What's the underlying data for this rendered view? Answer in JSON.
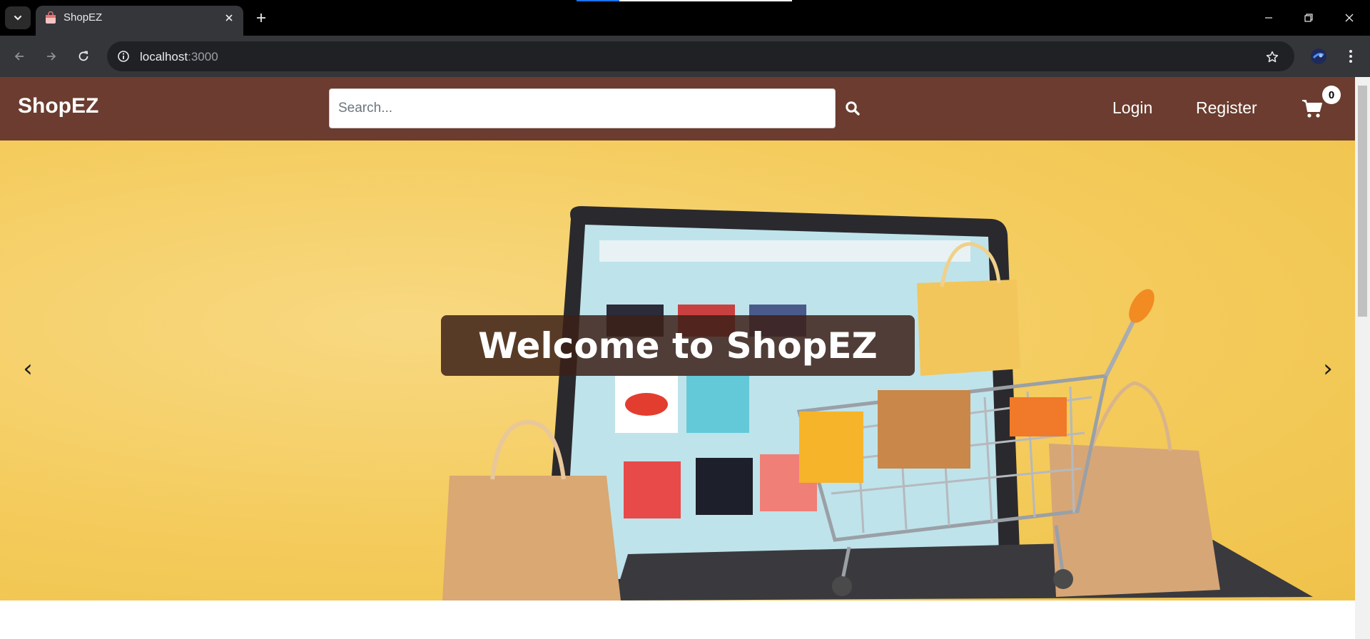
{
  "browser": {
    "tab_title": "ShopEZ",
    "url_host": "localhost",
    "url_port": ":3000"
  },
  "site": {
    "brand": "ShopEZ",
    "search_placeholder": "Search...",
    "nav": {
      "login": "Login",
      "register": "Register"
    },
    "cart_count": "0"
  },
  "hero": {
    "caption": "Welcome to ShopEZ",
    "prev_arrow": "‹",
    "next_arrow": "›"
  },
  "colors": {
    "header_bg": "#6b3c2f",
    "hero_bg": "#f4cb5c",
    "caption_bg": "#3c2018"
  }
}
